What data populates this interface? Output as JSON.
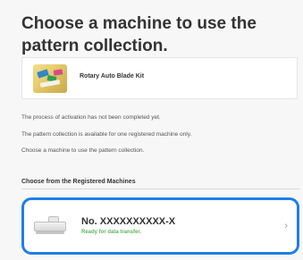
{
  "page": {
    "heading": "Choose a machine to use the pattern collection."
  },
  "product": {
    "name": "Rotary Auto Blade Kit",
    "image_icon": "product-thumbnail"
  },
  "info": {
    "lines": [
      "The process of activation has not been completed yet.",
      "The pattern collection is available for one registered machine only.",
      "Choose a machine to use the pattern collection."
    ]
  },
  "registered": {
    "section_title": "Choose from the Registered Machines",
    "machines": [
      {
        "name": "No. XXXXXXXXXX-X",
        "status": "Ready for data transfer.",
        "icon": "cutting-machine-icon",
        "chevron_icon": "chevron-right-icon"
      }
    ]
  },
  "colors": {
    "accent": "#1f7ee8",
    "status_ready": "#5cb85c",
    "text": "#333333"
  }
}
